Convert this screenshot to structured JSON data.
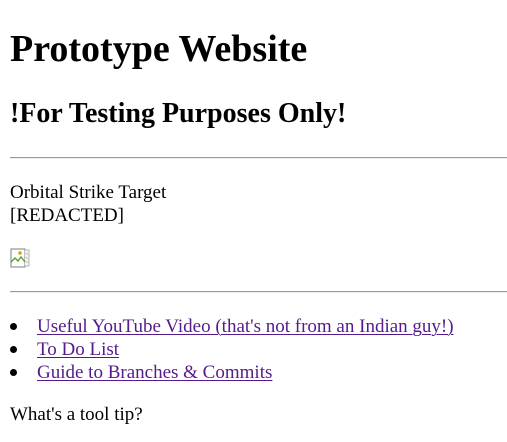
{
  "page": {
    "heading": "Prototype Website",
    "subheading": "!For Testing Purposes Only!"
  },
  "target": {
    "label": "Orbital Strike Target",
    "value": "[REDACTED]"
  },
  "image": {
    "icon": "broken-image-icon"
  },
  "links": [
    {
      "label": "Useful YouTube Video (that's not from an Indian guy!)"
    },
    {
      "label": "To Do List"
    },
    {
      "label": "Guide to Branches & Commits"
    }
  ],
  "tooltip": {
    "text": "What's a tool tip?"
  },
  "colors": {
    "background": "#ffffff",
    "text": "#000000",
    "visited_link": "#551a8b",
    "rule": "#9a9a9a"
  }
}
